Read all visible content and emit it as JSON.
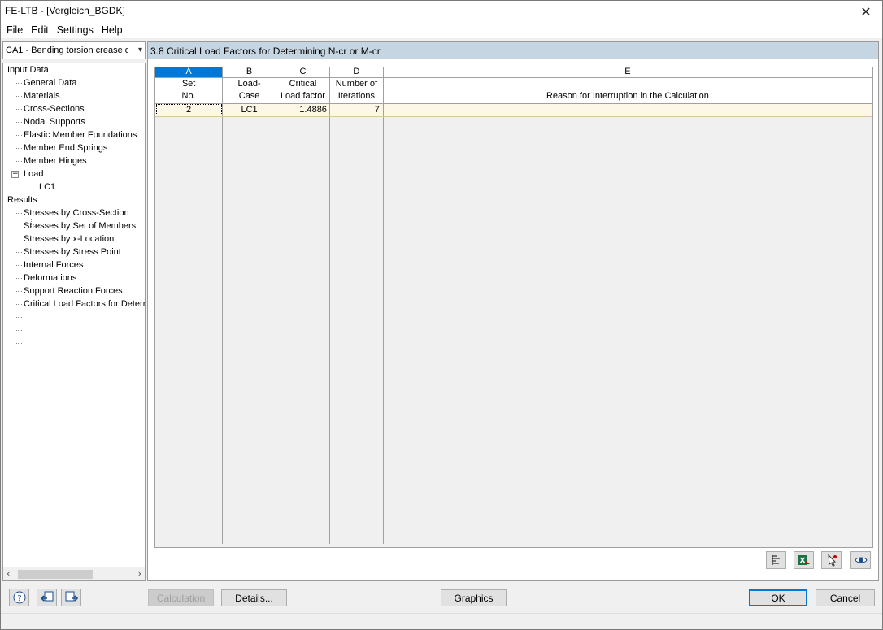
{
  "window": {
    "title": "FE-LTB - [Vergleich_BGDK]"
  },
  "menu": [
    "File",
    "Edit",
    "Settings",
    "Help"
  ],
  "case_selector": {
    "value": "CA1 - Bending torsion crease de"
  },
  "tree": {
    "input_data": {
      "label": "Input Data",
      "items": [
        "General Data",
        "Materials",
        "Cross-Sections",
        "Nodal Supports",
        "Elastic Member Foundations",
        "Member End Springs",
        "Member Hinges"
      ],
      "load": {
        "label": "Load",
        "children": [
          "LC1"
        ]
      }
    },
    "results": {
      "label": "Results",
      "items": [
        "Stresses by Cross-Section",
        "Stresses by Set of Members",
        "Stresses by x-Location",
        "Stresses by Stress Point",
        "Internal Forces",
        "Deformations",
        "Support Reaction Forces",
        "Critical Load Factors for Determ"
      ]
    }
  },
  "section_title": "3.8 Critical Load Factors for Determining N-cr or M-cr",
  "table": {
    "column_letters": [
      "A",
      "B",
      "C",
      "D",
      "E"
    ],
    "header_line1": [
      "Set",
      "Load-",
      "Critical",
      "Number of",
      ""
    ],
    "header_line2": [
      "No.",
      "Case",
      "Load factor",
      "Iterations",
      "Reason for Interruption in the Calculation"
    ],
    "rows": [
      [
        "2",
        "LC1",
        "1.4886",
        "7",
        ""
      ]
    ]
  },
  "table_toolbar_icons": [
    "sort-rows-icon",
    "excel-export-icon",
    "pick-select-icon",
    "view-eye-icon"
  ],
  "bottom_icons": [
    "help-icon",
    "import-icon",
    "export-icon"
  ],
  "buttons": {
    "calculation": "Calculation",
    "details": "Details...",
    "graphics": "Graphics",
    "ok": "OK",
    "cancel": "Cancel"
  },
  "colors": {
    "selected_column": "#0078d7",
    "section_header": "#c6d5e2",
    "data_row": "#fdf7e8"
  }
}
